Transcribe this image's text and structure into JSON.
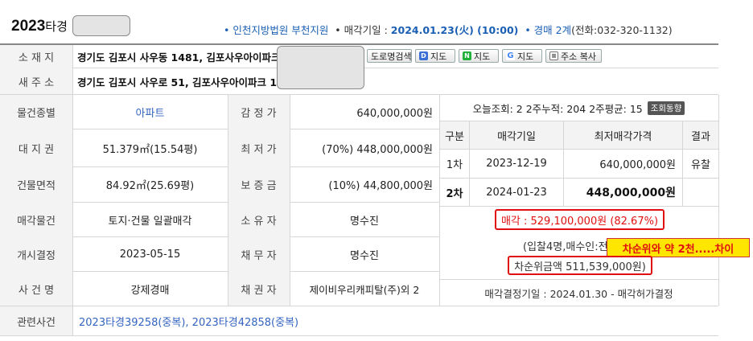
{
  "header": {
    "case_year": "2023",
    "case_suffix": "타경",
    "court": "• 인천지방법원 부천지원",
    "sale_date_label": "• 매각기일 : ",
    "sale_date": "2024.01.23(火) (10:00)",
    "auction_round_prefix": "• 경매 ",
    "auction_round": "2계",
    "tel": "(전화:032-320-1132)"
  },
  "address": {
    "lot_label": "소 재 지",
    "lot_value": "경기도 김포시 사우동 1481, 김포사우아이파크",
    "road_label": "새 주 소",
    "road_value": "경기도 김포시 사우로 51, 김포사우아이파크 1"
  },
  "buttons": {
    "road_search": "도로명검색",
    "daum_map": "지도",
    "naver_map": "지도",
    "google_map": "지도",
    "copy_address": "주소 복사"
  },
  "details": {
    "type_label": "물건종별",
    "type_value": "아파트",
    "land_label": "대 지 권",
    "land_value": "51.379㎡(15.54평)",
    "bldg_label": "건물면적",
    "bldg_value": "84.92㎡(25.69평)",
    "sale_obj_label": "매각물건",
    "sale_obj_value": "토지·건물 일괄매각",
    "open_label": "개시결정",
    "open_value": "2023-05-15",
    "case_label": "사 건 명",
    "case_value": "강제경매",
    "appraisal_label": "감 정 가",
    "appraisal_value": "640,000,000원",
    "min_label": "최 저 가",
    "min_value": "(70%) 448,000,000원",
    "deposit_label": "보 증 금",
    "deposit_value": "(10%) 44,800,000원",
    "owner_label": "소 유 자",
    "owner_value": "명수진",
    "debtor_label": "채 무 자",
    "debtor_value": "명수진",
    "creditor_label": "채 권 자",
    "creditor_value": "제이비우리캐피탈(주)외 2",
    "related_label": "관련사건",
    "related_value": "2023타경39258(중복), 2023타경42858(중복)"
  },
  "stats": {
    "text": "오늘조회: 2  2주누적: 204  2주평균: 15",
    "button": "조회동향"
  },
  "history": {
    "headers": [
      "구분",
      "매각기일",
      "최저매각가격",
      "결과"
    ],
    "rows": [
      {
        "round": "1차",
        "date": "2023-12-19",
        "price": "640,000,000원",
        "result": "유찰"
      },
      {
        "round": "2차",
        "date": "2024-01-23",
        "price": "448,000,000원",
        "result": ""
      }
    ]
  },
  "result": {
    "sale_text": "매각 : 529,100,000원  (82.67%)",
    "bidders_text": "(입찰4명,매수인:전",
    "second_text": "차순위금액 511,539,000원)",
    "decision_text": "매각결정기일 : 2024.01.30 - 매각허가결정",
    "note": "차순위와 약 2천.....차이"
  },
  "colors": {
    "accent_blue": "#1a5fb4",
    "highlight_red": "#e01010",
    "note_yellow": "#ffe600"
  }
}
